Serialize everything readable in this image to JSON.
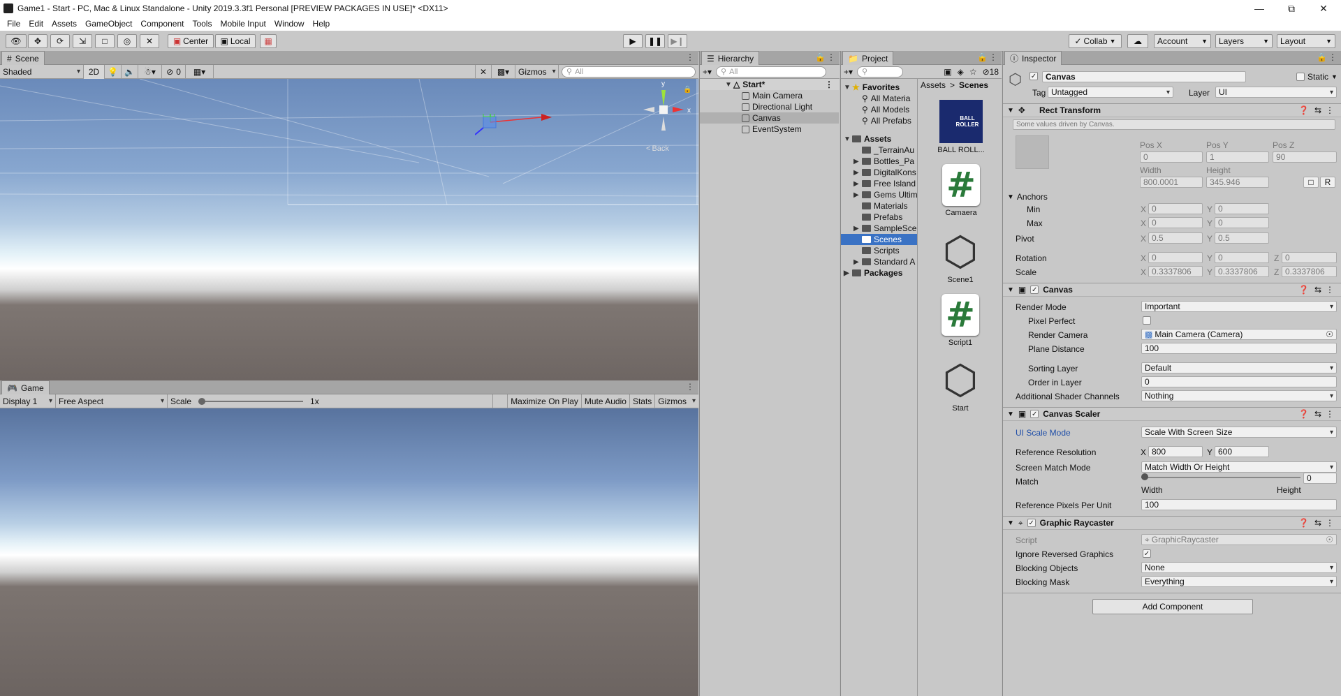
{
  "window": {
    "title": "Game1 - Start - PC, Mac & Linux Standalone - Unity 2019.3.3f1 Personal [PREVIEW PACKAGES IN USE]* <DX11>"
  },
  "menu": [
    "File",
    "Edit",
    "Assets",
    "GameObject",
    "Component",
    "Tools",
    "Mobile Input",
    "Window",
    "Help"
  ],
  "toolbar": {
    "pivot": "Center",
    "space": "Local",
    "collab": "Collab",
    "account": "Account",
    "layers": "Layers",
    "layout": "Layout"
  },
  "scene": {
    "tab": "Scene",
    "shading": "Shaded",
    "mode2d": "2D",
    "hidden_count": "0",
    "gizmos": "Gizmos",
    "search_placeholder": "All",
    "back_label": "Back",
    "axis_y": "y"
  },
  "game": {
    "tab": "Game",
    "display": "Display 1",
    "aspect": "Free Aspect",
    "scale_label": "Scale",
    "scale_value": "1x",
    "maximize": "Maximize On Play",
    "mute": "Mute Audio",
    "stats": "Stats",
    "gizmos": "Gizmos"
  },
  "hierarchy": {
    "tab": "Hierarchy",
    "search_placeholder": "All",
    "scene_name": "Start*",
    "items": [
      "Main Camera",
      "Directional Light",
      "Canvas",
      "EventSystem"
    ]
  },
  "project": {
    "tab": "Project",
    "hidden_count": "18",
    "favorites_label": "Favorites",
    "favorites": [
      "All Materia",
      "All Models",
      "All Prefabs"
    ],
    "assets_label": "Assets",
    "folders": [
      "_TerrainAu",
      "Bottles_Pa",
      "DigitalKons",
      "Free Island",
      "Gems Ultim",
      "Materials",
      "Prefabs",
      "SampleSce",
      "Scenes",
      "Scripts",
      "Standard A"
    ],
    "packages_label": "Packages",
    "breadcrumb": [
      "Assets",
      "Scenes"
    ],
    "files": [
      "BALL ROLL...",
      "Camaera",
      "Scene1",
      "Script1",
      "Start"
    ],
    "ball_thumb_text": "BALL ROLLER"
  },
  "inspector": {
    "tab": "Inspector",
    "object_name": "Canvas",
    "static_label": "Static",
    "tag_label": "Tag",
    "tag_value": "Untagged",
    "layer_label": "Layer",
    "layer_value": "UI",
    "rect_transform": {
      "title": "Rect Transform",
      "note": "Some values driven by Canvas.",
      "pos_x_label": "Pos X",
      "pos_y_label": "Pos Y",
      "pos_z_label": "Pos Z",
      "pos_x": "0",
      "pos_y": "1",
      "pos_z": "90",
      "width_label": "Width",
      "height_label": "Height",
      "width": "800.0001",
      "height": "345.946",
      "r_button": "R",
      "anchors_label": "Anchors",
      "min_label": "Min",
      "max_label": "Max",
      "min_x": "0",
      "min_y": "0",
      "max_x": "0",
      "max_y": "0",
      "pivot_label": "Pivot",
      "pivot_x": "0.5",
      "pivot_y": "0.5",
      "rotation_label": "Rotation",
      "rot_x": "0",
      "rot_y": "0",
      "rot_z": "0",
      "scale_label": "Scale",
      "scale_x": "0.3337806",
      "scale_y": "0.3337806",
      "scale_z": "0.3337806",
      "x": "X",
      "y": "Y",
      "z": "Z"
    },
    "canvas": {
      "title": "Canvas",
      "render_mode_label": "Render Mode",
      "render_mode": "Important",
      "pixel_perfect_label": "Pixel Perfect",
      "render_camera_label": "Render Camera",
      "render_camera": "Main Camera (Camera)",
      "plane_distance_label": "Plane Distance",
      "plane_distance": "100",
      "sorting_layer_label": "Sorting Layer",
      "sorting_layer": "Default",
      "order_label": "Order in Layer",
      "order": "0",
      "shader_channels_label": "Additional Shader Channels",
      "shader_channels": "Nothing"
    },
    "canvas_scaler": {
      "title": "Canvas Scaler",
      "ui_scale_label": "UI Scale Mode",
      "ui_scale": "Scale With Screen Size",
      "ref_res_label": "Reference Resolution",
      "ref_x": "800",
      "ref_y": "600",
      "match_mode_label": "Screen Match Mode",
      "match_mode": "Match Width Or Height",
      "match_label": "Match",
      "match_value": "0",
      "match_fraction": 0,
      "match_left": "Width",
      "match_right": "Height",
      "ppu_label": "Reference Pixels Per Unit",
      "ppu": "100"
    },
    "raycaster": {
      "title": "Graphic Raycaster",
      "script_label": "Script",
      "script": "GraphicRaycaster",
      "ignore_label": "Ignore Reversed Graphics",
      "blocking_objects_label": "Blocking Objects",
      "blocking_objects": "None",
      "blocking_mask_label": "Blocking Mask",
      "blocking_mask": "Everything"
    },
    "add_component": "Add Component"
  }
}
